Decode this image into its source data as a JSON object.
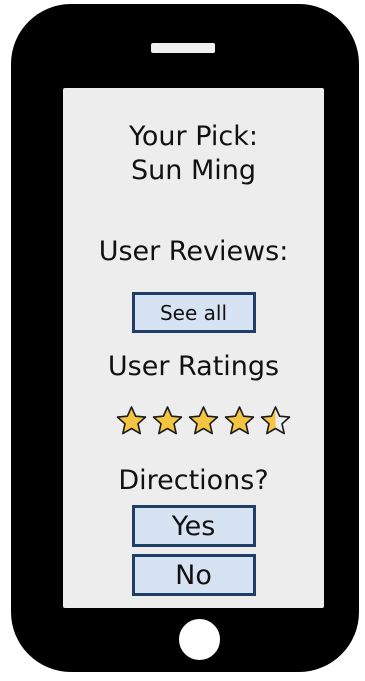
{
  "screen": {
    "title_line1": "Your Pick:",
    "title_line2": "Sun Ming",
    "reviews_label": "User Reviews:",
    "see_all_label": "See all",
    "ratings_label": "User Ratings",
    "rating": {
      "value": 4.5,
      "max": 5,
      "star_fill_color": "#f5c542",
      "star_outline_color": "#1a1a1a"
    },
    "directions_label": "Directions?",
    "yes_label": "Yes",
    "no_label": "No"
  },
  "colors": {
    "phone_body": "#000000",
    "screen_bg": "#ededed",
    "button_bg": "#d7e3f2",
    "button_border": "#1f3f68"
  }
}
